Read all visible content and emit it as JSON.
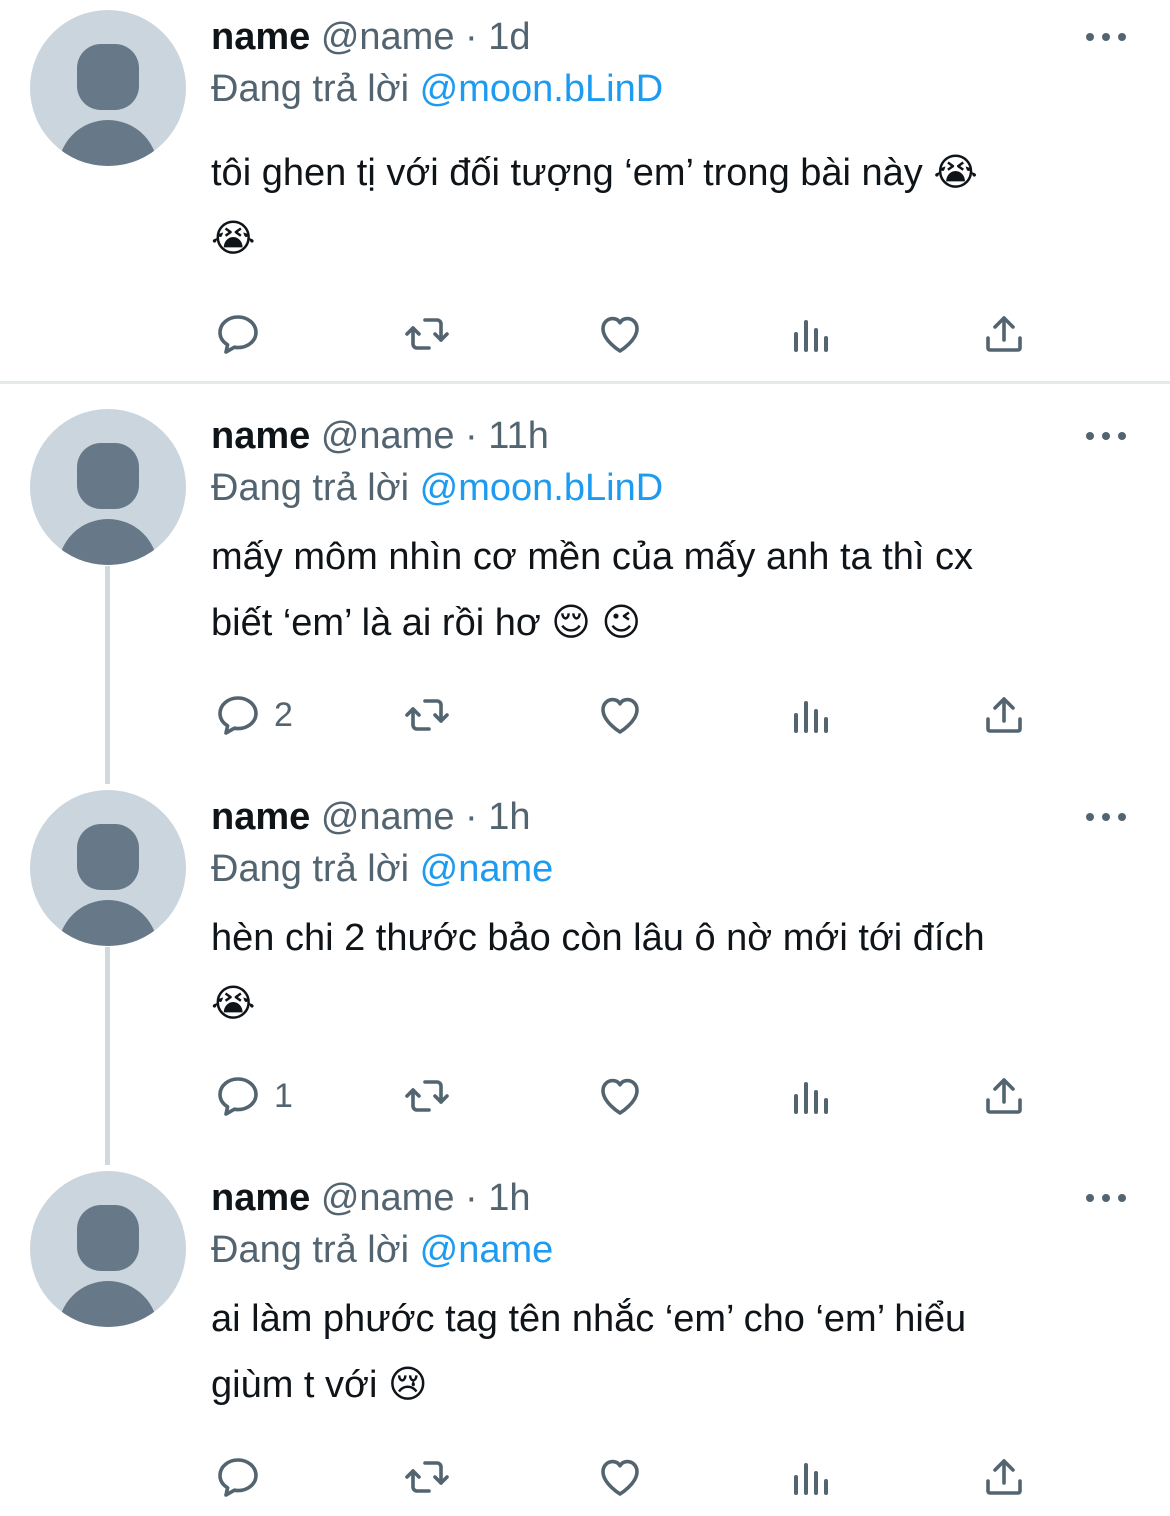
{
  "tweets": [
    {
      "display_name": "name",
      "handle": "@name",
      "dot": "·",
      "time": "1d",
      "reply_prefix": "Đang trả lời",
      "reply_to": "@moon.bLinD",
      "text_line1": "tôi ghen tị với đối tượng ‘em’ trong bài này 😭",
      "text_line2": "😭",
      "reply_count": "",
      "icons": {
        "reply": "reply-icon",
        "retweet": "retweet-icon",
        "like": "heart-icon",
        "views": "views-icon",
        "share": "share-icon"
      }
    },
    {
      "display_name": "name",
      "handle": "@name",
      "dot": "·",
      "time": "11h",
      "reply_prefix": "Đang trả lời",
      "reply_to": "@moon.bLinD",
      "text_line1": "mấy môm nhìn cơ mền của mấy anh ta thì cx",
      "text_line2": "biết ‘em’ là ai rồi hơ 😌 😉",
      "reply_count": "2",
      "icons": {
        "reply": "reply-icon",
        "retweet": "retweet-icon",
        "like": "heart-icon",
        "views": "views-icon",
        "share": "share-icon"
      }
    },
    {
      "display_name": "name",
      "handle": "@name",
      "dot": "·",
      "time": "1h",
      "reply_prefix": "Đang trả lời",
      "reply_to": "@name",
      "text_line1": "hèn chi 2 thước bảo còn lâu ô nờ mới tới đích",
      "text_line2": "😭",
      "reply_count": "1",
      "icons": {
        "reply": "reply-icon",
        "retweet": "retweet-icon",
        "like": "heart-icon",
        "views": "views-icon",
        "share": "share-icon"
      }
    },
    {
      "display_name": "name",
      "handle": "@name",
      "dot": "·",
      "time": "1h",
      "reply_prefix": "Đang trả lời",
      "reply_to": "@name",
      "text_line1": "ai làm phước tag tên nhắc ‘em’ cho ‘em’ hiểu",
      "text_line2": "giùm t với 😢",
      "reply_count": "",
      "icons": {
        "reply": "reply-icon",
        "retweet": "retweet-icon",
        "like": "heart-icon",
        "views": "views-icon",
        "share": "share-icon"
      }
    }
  ],
  "colors": {
    "link": "#1d9bf0",
    "secondary_text": "#536471",
    "primary_text": "#0f1419",
    "avatar_bg": "#cbd5dd",
    "avatar_fg": "#677888",
    "thread_line": "#cfd9de"
  }
}
